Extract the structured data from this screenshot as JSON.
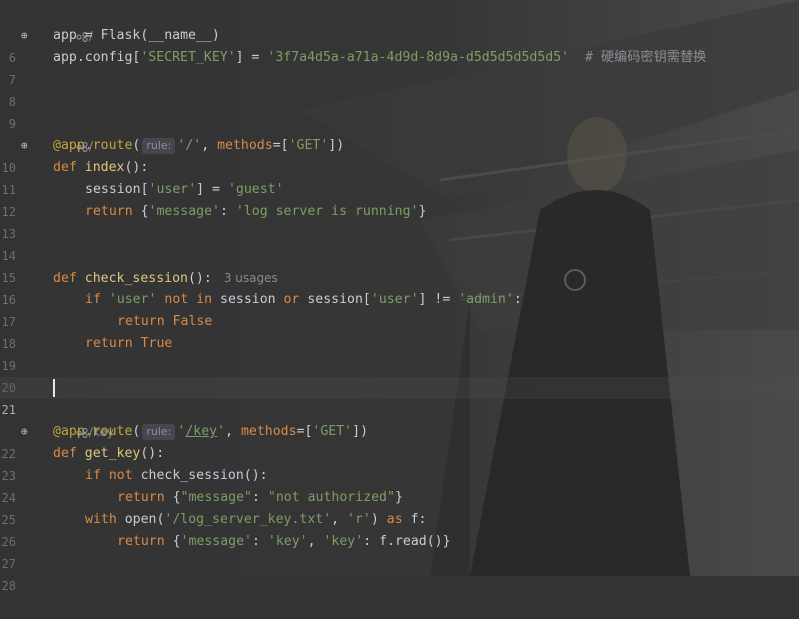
{
  "editor": {
    "lines": [
      {
        "endpoint": "/"
      },
      {
        "num": "6",
        "gutter_icon": true,
        "text": [
          "app",
          " = ",
          "Flask",
          "(",
          "__name__",
          ")"
        ]
      },
      {
        "num": "7",
        "parts": {
          "a": "app",
          "b": ".config[",
          "c": "'SECRET_KEY'",
          "d": "] = ",
          "e": "'3f7a4d5a-a71a-4d9d-8d9a-d5d5d5d5d5d5'",
          "f": "  # 硬编码密钥需替换"
        }
      },
      {
        "num": "8"
      },
      {
        "num": "9"
      },
      {
        "endpoint": "/"
      },
      {
        "num": "10",
        "gutter_icon": true,
        "parts": {
          "a": "@app.route",
          "b": "(",
          "hint": "rule:",
          "c": "'/'",
          "d": ", ",
          "e": "methods",
          "f": "=[",
          "g": "'GET'",
          "h": "])"
        }
      },
      {
        "num": "11",
        "parts": {
          "a": "def ",
          "b": "index",
          "c": "():"
        }
      },
      {
        "num": "12",
        "parts": {
          "a": "session[",
          "b": "'user'",
          "c": "] = ",
          "d": "'guest'"
        }
      },
      {
        "num": "13",
        "parts": {
          "a": "return ",
          "b": "{",
          "c": "'message'",
          "d": ": ",
          "e": "'log server is running'",
          "f": "}"
        }
      },
      {
        "num": "14"
      },
      {
        "num": "15"
      },
      {
        "num": "16",
        "parts": {
          "a": "def ",
          "b": "check_session",
          "c": "():",
          "usages": "3 usages"
        }
      },
      {
        "num": "17",
        "parts": {
          "a": "if ",
          "b": "'user'",
          "c": " not in ",
          "d": "session ",
          "e": "or ",
          "f": "session[",
          "g": "'user'",
          "h": "] != ",
          "i": "'admin'",
          "j": ":"
        }
      },
      {
        "num": "18",
        "parts": {
          "a": "return ",
          "b": "False"
        }
      },
      {
        "num": "19",
        "parts": {
          "a": "return ",
          "b": "True"
        }
      },
      {
        "num": "20"
      },
      {
        "num": "21"
      },
      {
        "endpoint": "/key"
      },
      {
        "num": "22",
        "gutter_icon": true,
        "parts": {
          "a": "@app.route",
          "b": "(",
          "hint": "rule:",
          "c1": "'",
          "c2": "/key",
          "c3": "'",
          "d": ", ",
          "e": "methods",
          "f": "=[",
          "g": "'GET'",
          "h": "])"
        }
      },
      {
        "num": "23",
        "parts": {
          "a": "def ",
          "b": "get_key",
          "c": "():"
        }
      },
      {
        "num": "24",
        "parts": {
          "a": "if ",
          "b": "not ",
          "c": "check_session():"
        }
      },
      {
        "num": "25",
        "parts": {
          "a": "return ",
          "b": "{",
          "c": "\"message\"",
          "d": ": ",
          "e": "\"not authorized\"",
          "f": "}"
        }
      },
      {
        "num": "26",
        "parts": {
          "a": "with ",
          "b": "open",
          "c": "(",
          "d": "'/log_server_key.txt'",
          "e": ", ",
          "f": "'r'",
          "g": ") ",
          "h": "as ",
          "i": "f:"
        }
      },
      {
        "num": "27",
        "parts": {
          "a": "return ",
          "b": "{",
          "c": "'message'",
          "d": ": ",
          "e": "'key'",
          "f": ", ",
          "g": "'key'",
          "h": ": f.read()}"
        }
      },
      {
        "num": "28"
      }
    ]
  }
}
